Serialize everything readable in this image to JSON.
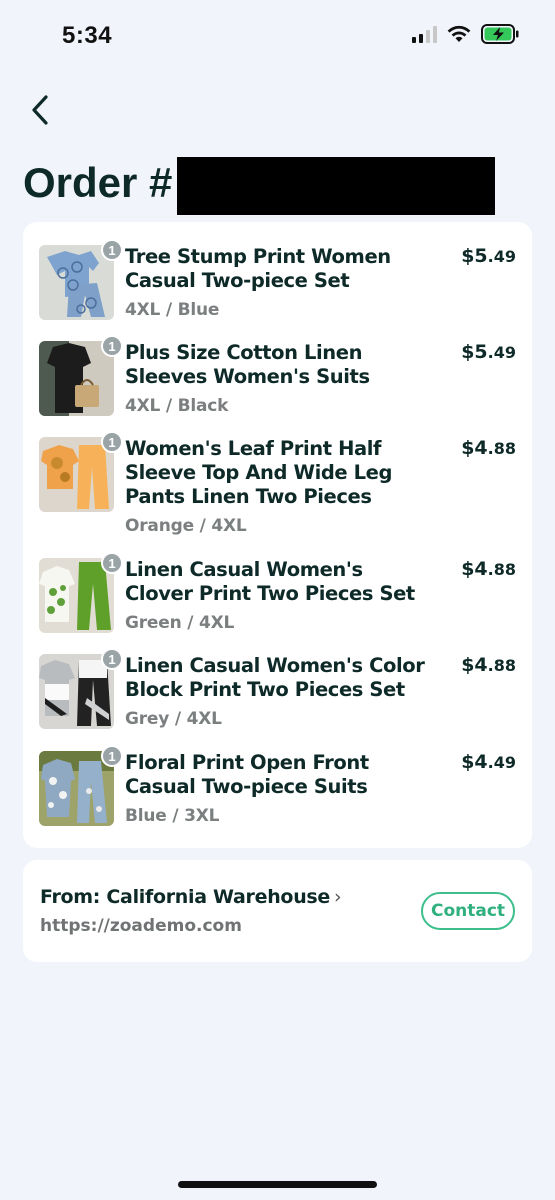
{
  "status": {
    "time": "5:34"
  },
  "header": {
    "title": "Order #"
  },
  "items": [
    {
      "name": "Tree Stump Print Women Casual Two-piece Set",
      "variant": "4XL / Blue",
      "price_whole": "$5",
      "price_cents": ".49",
      "qty": "1"
    },
    {
      "name": "Plus Size Cotton Linen Sleeves Women's Suits",
      "variant": "4XL / Black",
      "price_whole": "$5",
      "price_cents": ".49",
      "qty": "1"
    },
    {
      "name": "Women's Leaf Print Half Sleeve Top And Wide Leg Pants Linen Two Pieces",
      "variant": "Orange / 4XL",
      "price_whole": "$4",
      "price_cents": ".88",
      "qty": "1"
    },
    {
      "name": "Linen Casual Women's Clover Print Two Pieces Set",
      "variant": "Green / 4XL",
      "price_whole": "$4",
      "price_cents": ".88",
      "qty": "1"
    },
    {
      "name": "Linen Casual Women's Color Block Print Two Pieces Set",
      "variant": "Grey / 4XL",
      "price_whole": "$4",
      "price_cents": ".88",
      "qty": "1"
    },
    {
      "name": "Floral Print Open Front Casual Two-piece Suits",
      "variant": "Blue / 3XL",
      "price_whole": "$4",
      "price_cents": ".49",
      "qty": "1"
    }
  ],
  "from": {
    "label": "From: California Warehouse",
    "url": "https://zoademo.com",
    "contact_label": "Contact"
  }
}
